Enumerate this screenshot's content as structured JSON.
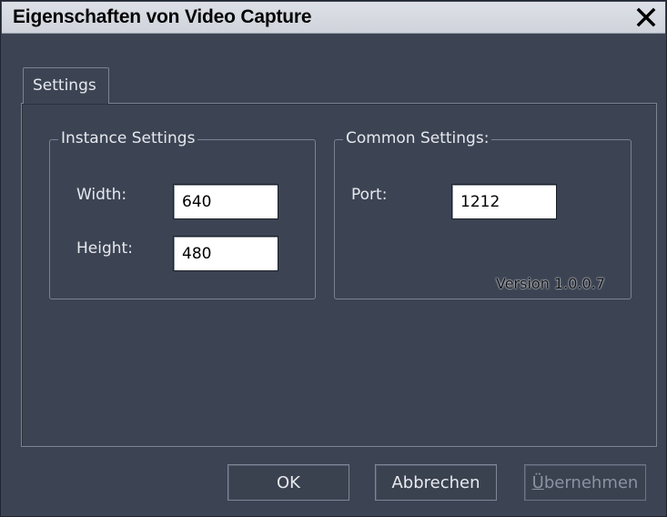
{
  "window": {
    "title": "Eigenschaften von Video Capture",
    "close_icon": "close-icon"
  },
  "tabs": [
    {
      "label": "Settings",
      "selected": true
    }
  ],
  "instance_settings": {
    "title": "Instance Settings",
    "width_label": "Width:",
    "width_value": "640",
    "height_label": "Height:",
    "height_value": "480"
  },
  "common_settings": {
    "title": "Common Settings:",
    "port_label": "Port:",
    "port_value": "1212",
    "version": "Version 1.0.0.7"
  },
  "buttons": {
    "ok": "OK",
    "cancel": "Abbrechen",
    "apply_first": "Ü",
    "apply_rest": "bernehmen",
    "apply_enabled": false
  },
  "colors": {
    "window_bg": "#3c4453",
    "titlebar_bg": "#d6d9e0",
    "text": "#e6e8ee"
  }
}
